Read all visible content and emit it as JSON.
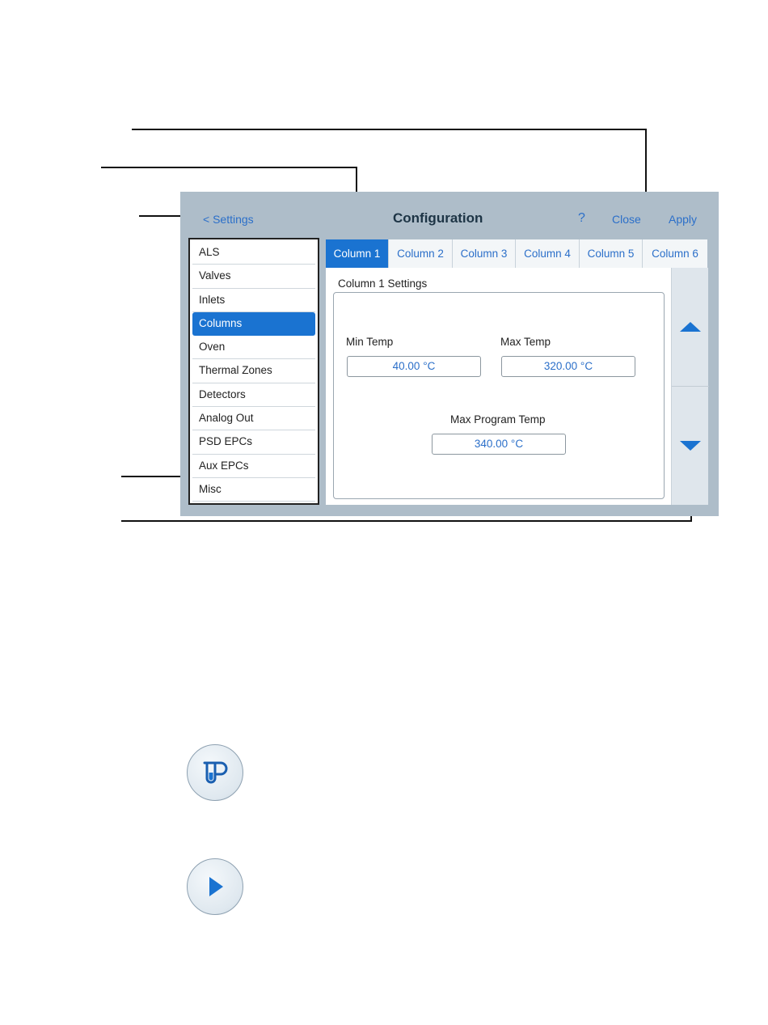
{
  "header": {
    "back_label": "< Settings",
    "title": "Configuration",
    "help_label": "?",
    "close_label": "Close",
    "apply_label": "Apply"
  },
  "sidebar": {
    "items": [
      {
        "label": "ALS"
      },
      {
        "label": "Valves"
      },
      {
        "label": "Inlets"
      },
      {
        "label": "Columns",
        "active": true
      },
      {
        "label": "Oven"
      },
      {
        "label": "Thermal Zones"
      },
      {
        "label": "Detectors"
      },
      {
        "label": "Analog Out"
      },
      {
        "label": "PSD EPCs"
      },
      {
        "label": "Aux EPCs"
      },
      {
        "label": "Misc"
      }
    ]
  },
  "tabs": [
    {
      "label": "Column 1",
      "active": true
    },
    {
      "label": "Column 2"
    },
    {
      "label": "Column 3"
    },
    {
      "label": "Column 4"
    },
    {
      "label": "Column 5"
    },
    {
      "label": "Column 6"
    }
  ],
  "content": {
    "section_title": "Column 1 Settings",
    "min_temp": {
      "label": "Min Temp",
      "value": "40.00 °C"
    },
    "max_temp": {
      "label": "Max Temp",
      "value": "320.00 °C"
    },
    "max_program_temp": {
      "label": "Max Program Temp",
      "value": "340.00 °C"
    }
  },
  "icons": {
    "scroll_up": "triangle-up-icon",
    "scroll_down": "triangle-down-icon",
    "method_button": "test-tube-p-icon",
    "start_button": "play-icon"
  },
  "colors": {
    "accent": "#1a73d1",
    "panel_bg": "#aebdc9",
    "link": "#2b6fc9"
  }
}
